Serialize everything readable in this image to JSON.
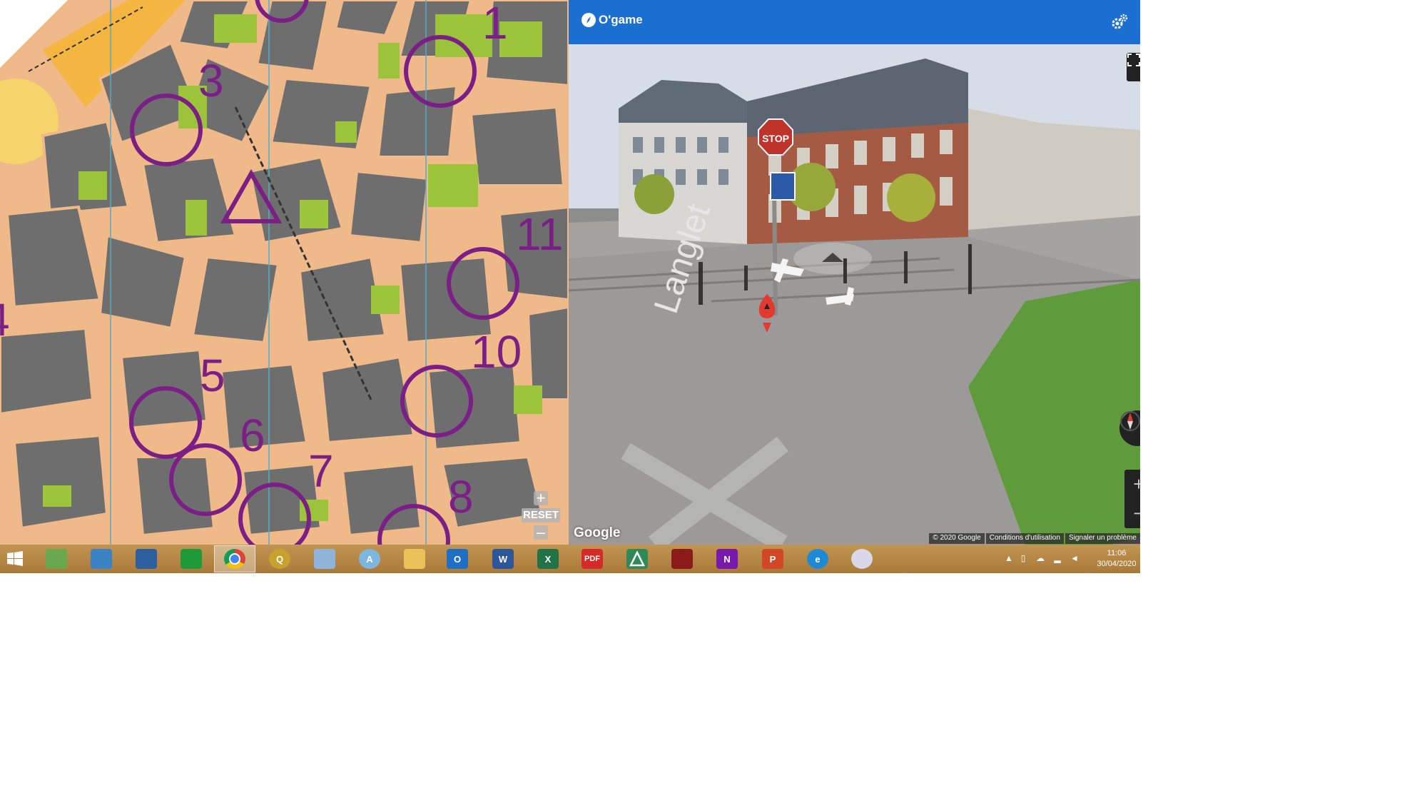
{
  "app": {
    "title": "O'game",
    "brand_color": "#1b6fd0",
    "icons": {
      "logo": "compass-icon",
      "settings": "gears-icon"
    }
  },
  "map": {
    "control_numbers": [
      "1",
      "3",
      "4",
      "5",
      "6",
      "7",
      "8",
      "10",
      "11"
    ],
    "reset_label": "RESET",
    "zoom_in_label": "+",
    "zoom_out_label": "–",
    "circle_color": "#7b1f87"
  },
  "side_tools": [
    {
      "name": "map-icon"
    },
    {
      "name": "info-icon"
    },
    {
      "name": "trophy-icon"
    },
    {
      "name": "thermometer-icon"
    },
    {
      "name": "refresh-icon"
    }
  ],
  "street_view": {
    "street_sign_text": "Langlet",
    "stop_sign": "STOP",
    "google_logo": "Google",
    "footer": [
      "© 2020 Google",
      "Conditions d'utilisation",
      "Signaler un problème"
    ],
    "zoom_in": "+",
    "zoom_out": "−"
  },
  "taskbar": {
    "apps": [
      "windows-start",
      "evernote",
      "remote-desktop",
      "network-monitor",
      "store",
      "chrome",
      "qgis",
      "control-panel",
      "autodesk",
      "file-explorer",
      "outlook",
      "word",
      "excel",
      "pdf",
      "app-a",
      "acrobat-reader",
      "onenote",
      "powerpoint",
      "internet-explorer",
      "paint"
    ],
    "labels": {
      "pdf": "PDF",
      "word": "W",
      "excel": "X",
      "onenote": "N",
      "powerpoint": "P",
      "outlook": "O"
    },
    "time": "11:06",
    "date": "30/04/2020"
  }
}
